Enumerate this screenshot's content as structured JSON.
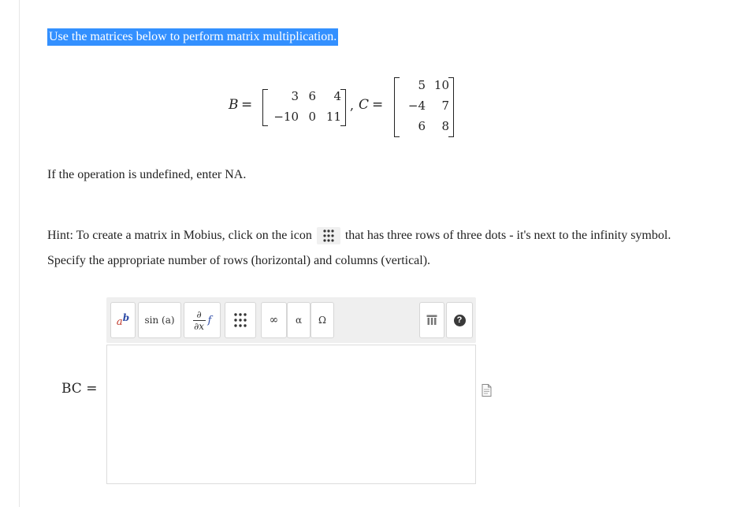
{
  "instruction": "Use the matrices below to perform matrix multiplication.",
  "equation": {
    "b_symbol": "B",
    "c_symbol": "C",
    "equals": "=",
    "separator": ",",
    "b_rows": [
      [
        "3",
        "6",
        "4"
      ],
      [
        "−10",
        "0",
        "11"
      ]
    ],
    "c_rows": [
      [
        "5",
        "10"
      ],
      [
        "−4",
        "7"
      ],
      [
        "6",
        "8"
      ]
    ]
  },
  "undefined_note": "If the operation is undefined, enter NA.",
  "hint": {
    "before": "Hint: To create a matrix in Mobius, click on the icon",
    "after": "that has three rows of three dots - it's next to the infinity symbol. Specify the appropriate number of rows (horizontal) and columns (vertical)."
  },
  "toolbar": {
    "superscript_base": "a",
    "superscript_exp": "b",
    "sin_label": "sin (a)",
    "partial_top": "∂",
    "partial_bottom": "∂x",
    "partial_f": "f",
    "infinity": "∞",
    "alpha": "α",
    "omega": "Ω",
    "help": "?"
  },
  "answer": {
    "label": "BC =",
    "value": ""
  },
  "colors": {
    "selection": "#3390ff",
    "toolbar_bg": "#efefef",
    "superscript_red": "#c0392b",
    "superscript_blue": "#2c4aa6"
  }
}
